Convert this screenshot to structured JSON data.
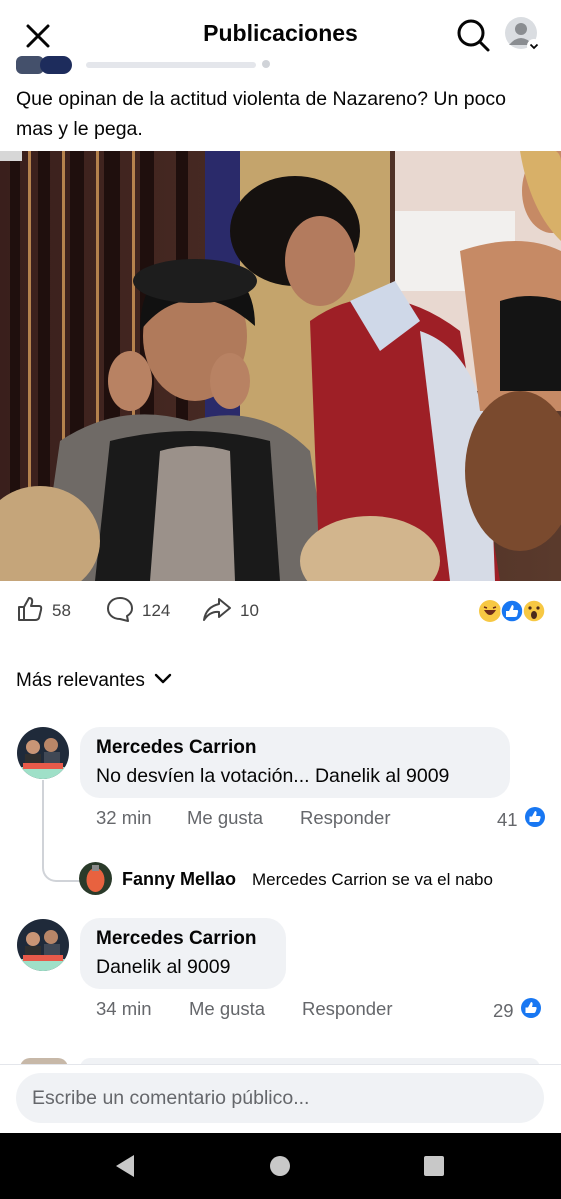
{
  "header": {
    "title": "Publicaciones"
  },
  "post": {
    "text": "Que opinan de la actitud violenta de Nazareno? Un poco mas y le pega.",
    "likes": "58",
    "comments": "124",
    "shares": "10"
  },
  "sort": {
    "label": "Más relevantes"
  },
  "comments": [
    {
      "author": "Mercedes Carrion",
      "text": "No desvíen la votación... Danelik al 9009",
      "time": "32 min",
      "like_label": "Me gusta",
      "reply_label": "Responder",
      "like_count": "41"
    },
    {
      "author": "Mercedes Carrion",
      "text": "Danelik al 9009",
      "time": "34 min",
      "like_label": "Me gusta",
      "reply_label": "Responder",
      "like_count": "29"
    }
  ],
  "reply": {
    "author": "Fanny Mellao",
    "text": "Mercedes Carrion se va el nabo"
  },
  "composer": {
    "placeholder": "Escribe un comentario público..."
  },
  "colors": {
    "brand": "#1877f2",
    "bubble": "#f0f2f5",
    "meta": "#65676b"
  }
}
